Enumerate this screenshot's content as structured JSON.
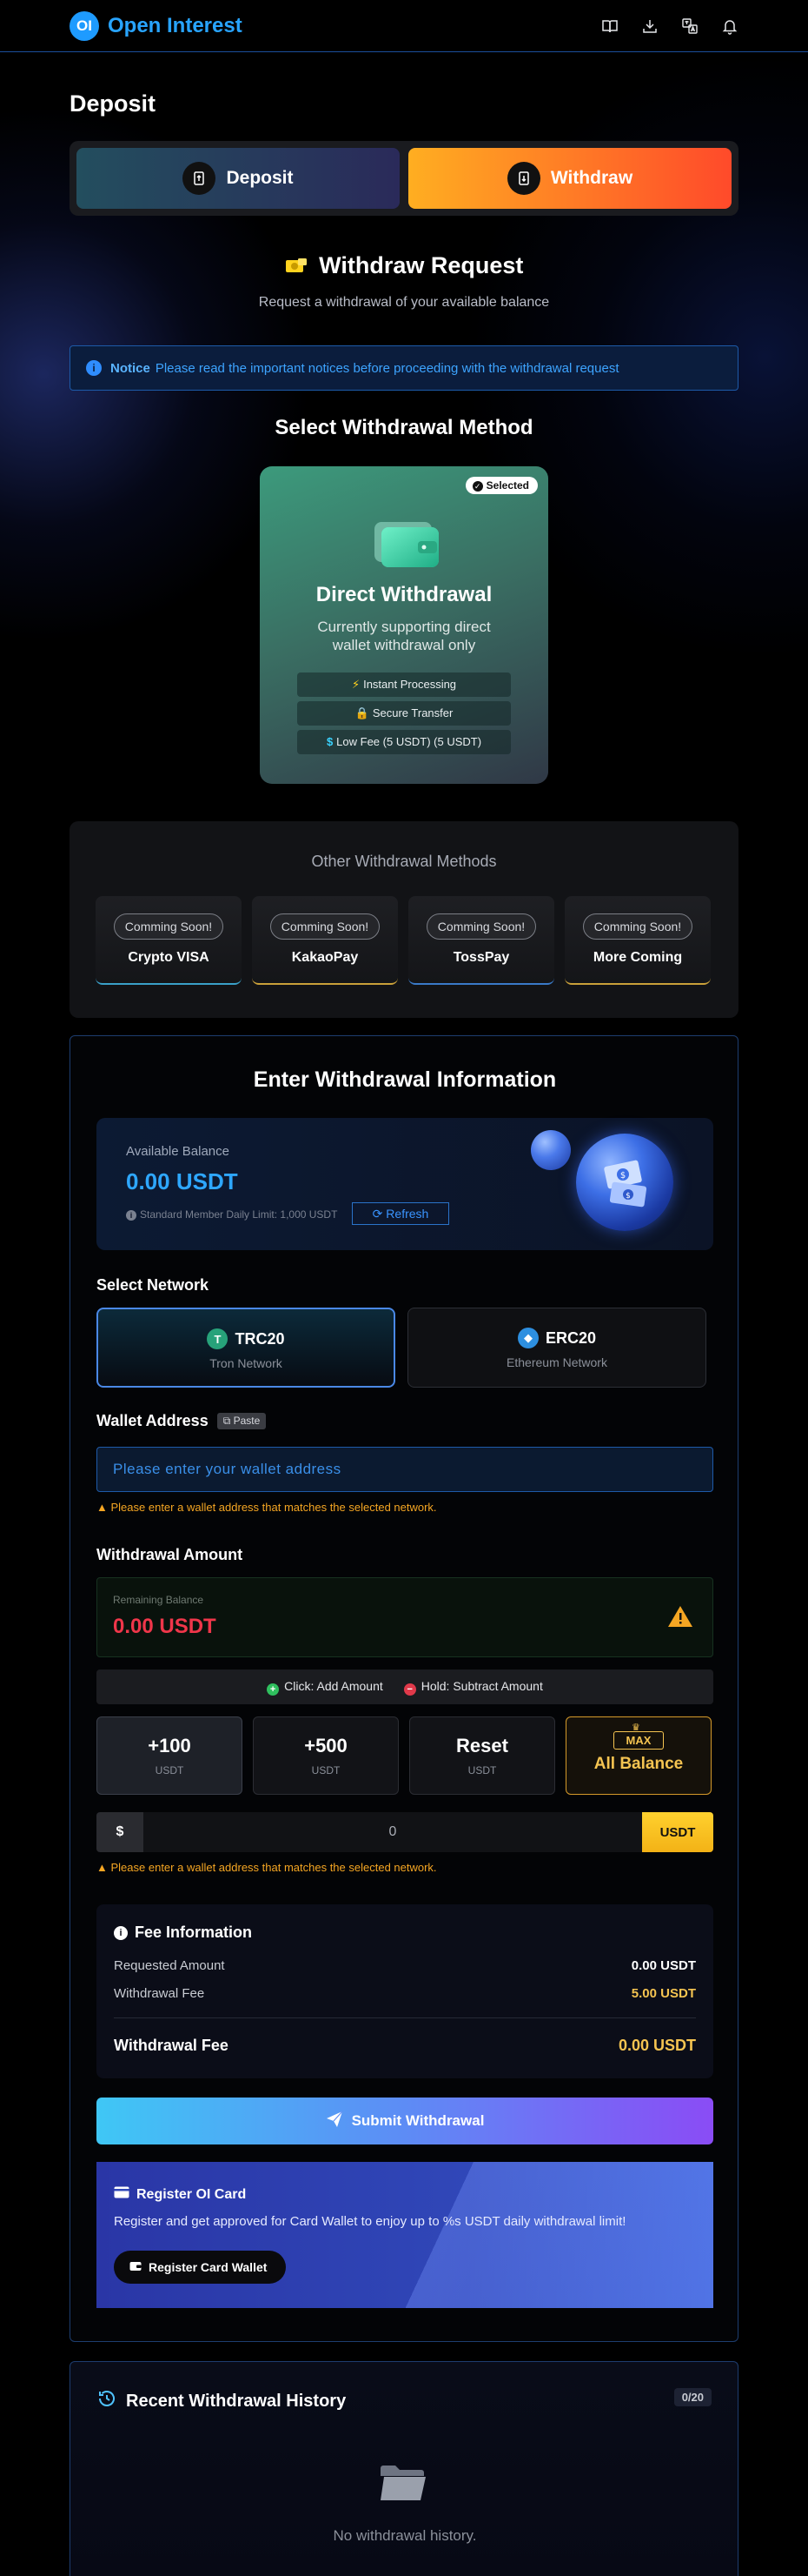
{
  "header": {
    "logo_mark": "OI",
    "app_name": "Open Interest",
    "icons": [
      "book-icon",
      "download-icon",
      "translate-icon",
      "bell-icon"
    ]
  },
  "page": {
    "title": "Deposit",
    "tabs": [
      {
        "label": "Deposit",
        "icon": "deposit-icon",
        "active": false
      },
      {
        "label": "Withdraw",
        "icon": "withdraw-icon",
        "active": true
      }
    ]
  },
  "request": {
    "title": "Withdraw Request",
    "subtitle": "Request a withdrawal of your available balance"
  },
  "notice": {
    "label": "Notice",
    "text": "Please read the important notices before proceeding with the withdrawal request"
  },
  "method_section": {
    "title": "Select Withdrawal Method",
    "direct": {
      "selected_label": "Selected",
      "title": "Direct Withdrawal",
      "subtitle": "Currently supporting direct wallet withdrawal only",
      "features": [
        {
          "icon": "lightning-icon",
          "label": "Instant Processing"
        },
        {
          "icon": "lock-icon",
          "label": "Secure Transfer"
        },
        {
          "icon": "dollar-icon",
          "label": "Low Fee (5 USDT) (5 USDT)"
        }
      ]
    }
  },
  "other_methods": {
    "title": "Other Withdrawal Methods",
    "items": [
      {
        "badge": "Comming Soon!",
        "name": "Crypto VISA",
        "accent": "#3aa0c8"
      },
      {
        "badge": "Comming Soon!",
        "name": "KakaoPay",
        "accent": "#c9a03a"
      },
      {
        "badge": "Comming Soon!",
        "name": "TossPay",
        "accent": "#3a7ac8"
      },
      {
        "badge": "Comming Soon!",
        "name": "More Coming",
        "accent": "#c9a03a"
      }
    ]
  },
  "form": {
    "title": "Enter Withdrawal Information",
    "balance": {
      "label": "Available Balance",
      "value": "0.00 USDT",
      "limit": "Standard Member Daily Limit: 1,000 USDT",
      "refresh_label": "Refresh"
    },
    "network": {
      "label": "Select Network",
      "options": [
        {
          "name": "TRC20",
          "sub": "Tron Network",
          "selected": true,
          "color": "#27a27a"
        },
        {
          "name": "ERC20",
          "sub": "Ethereum Network",
          "selected": false,
          "color": "#2d8fe0"
        }
      ]
    },
    "wallet": {
      "label": "Wallet Address",
      "paste_label": "Paste",
      "placeholder": "Please enter your wallet address",
      "warning": "Please enter a wallet address that matches the selected network."
    },
    "amount": {
      "label": "Withdrawal Amount",
      "remaining_label": "Remaining Balance",
      "remaining_value": "0.00 USDT",
      "hint_add": "Click: Add Amount",
      "hint_subtract": "Hold: Subtract Amount",
      "buttons": [
        {
          "value": "+100",
          "unit": "USDT"
        },
        {
          "value": "+500",
          "unit": "USDT"
        },
        {
          "value": "Reset",
          "unit": "USDT"
        }
      ],
      "max": {
        "tag": "MAX",
        "label": "All Balance"
      },
      "prefix": "$",
      "input_value": "0",
      "suffix": "USDT",
      "warning": "Please enter a wallet address that matches the selected network."
    },
    "fee": {
      "title": "Fee Information",
      "rows": [
        {
          "label": "Requested Amount",
          "value": "0.00 USDT"
        },
        {
          "label": "Withdrawal Fee",
          "value": "5.00 USDT"
        }
      ],
      "total_label": "Withdrawal Fee",
      "total_value": "0.00 USDT"
    },
    "submit_label": "Submit Withdrawal",
    "promo": {
      "title": "Register OI Card",
      "text": "Register and get approved for Card Wallet to enjoy up to %s USDT daily withdrawal limit!",
      "button": "Register Card Wallet"
    }
  },
  "history": {
    "title": "Recent Withdrawal History",
    "count": "0/20",
    "empty_text": "No withdrawal history."
  },
  "colors": {
    "accent_blue": "#2ea7ff",
    "accent_gold": "#f5c451",
    "danger": "#f0364a",
    "warning": "#f5a623"
  }
}
